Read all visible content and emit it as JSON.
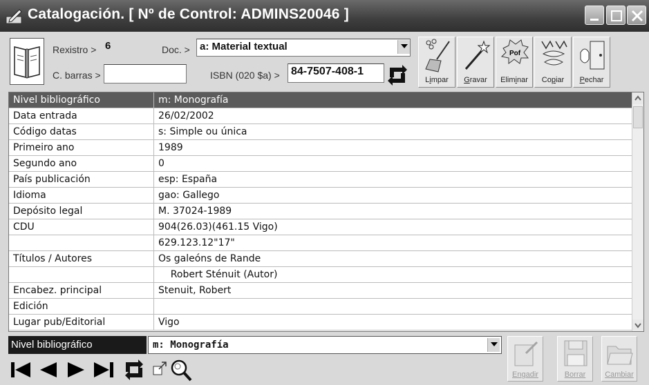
{
  "window": {
    "title": "Catalogación. [ Nº de Control: ADMINS20046 ]"
  },
  "header": {
    "rexistro_label": "Rexistro >",
    "rexistro_value": "6",
    "doc_label": "Doc. >",
    "doc_value": "a: Material textual",
    "cbarras_label": "C. barras >",
    "cbarras_value": "",
    "isbn_label": "ISBN (020 $a) >",
    "isbn_value": "84-7507-408-1"
  },
  "toolbar": {
    "limpar": "Limpar",
    "gravar": "Gravar",
    "eliminar": "Eliminar",
    "copiar": "Copiar",
    "pechar": "Pechar"
  },
  "grid": {
    "rows": [
      {
        "field": "Nivel bibliográfico",
        "value": "m: Monografía"
      },
      {
        "field": "Data entrada",
        "value": "26/02/2002"
      },
      {
        "field": "Código datas",
        "value": "s: Simple ou única"
      },
      {
        "field": "Primeiro ano",
        "value": "1989"
      },
      {
        "field": "Segundo ano",
        "value": "0"
      },
      {
        "field": "País publicación",
        "value": "esp: España"
      },
      {
        "field": "Idioma",
        "value": "gao: Gallego"
      },
      {
        "field": "Depósito legal",
        "value": "M. 37024-1989"
      },
      {
        "field": "CDU",
        "value": "904(26.03)(461.15 Vigo)"
      },
      {
        "field": "",
        "value": "629.123.12\"17\""
      },
      {
        "field": "Títulos / Autores",
        "value": "Os galeóns de Rande"
      },
      {
        "field": "",
        "value": "    Robert Sténuit (Autor)"
      },
      {
        "field": "Encabez. principal",
        "value": "Stenuit, Robert"
      },
      {
        "field": "Edición",
        "value": ""
      },
      {
        "field": "Lugar pub/Editorial",
        "value": "Vigo"
      }
    ]
  },
  "bottom": {
    "level_label": "Nivel bibliográfico",
    "level_value": "m: Monografía",
    "engadir": "Engadir",
    "borrar": "Borrar",
    "cambiar": "Cambiar"
  }
}
